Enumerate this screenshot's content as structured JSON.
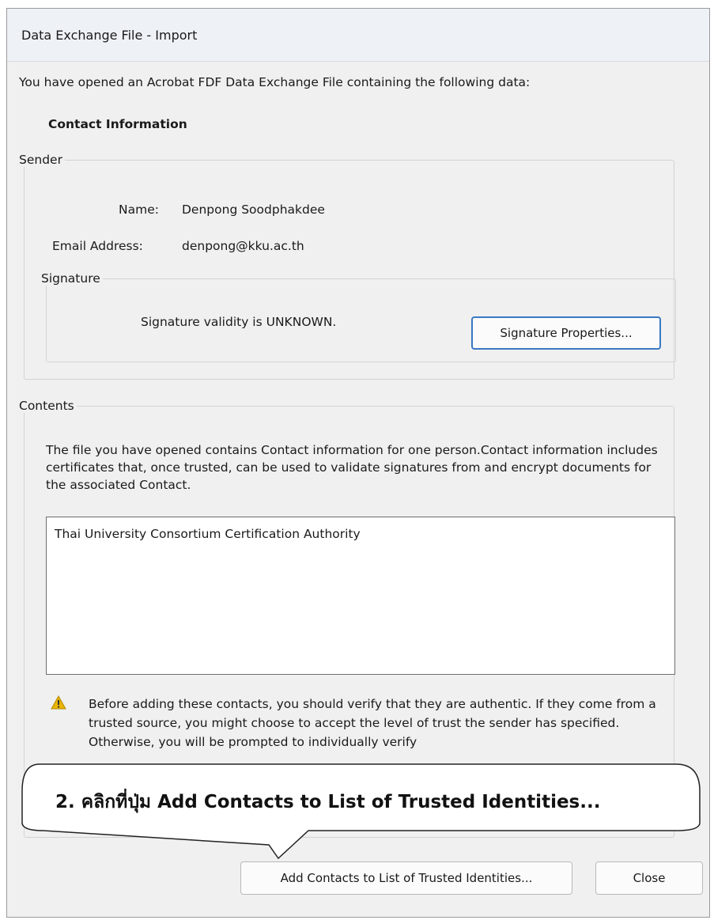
{
  "window": {
    "title": "Data Exchange File - Import"
  },
  "intro_text": "You have opened an Acrobat FDF Data Exchange File containing the following data:",
  "section_heading": "Contact Information",
  "sender": {
    "legend": "Sender",
    "name_label": "Name:",
    "name_value": "Denpong Soodphakdee",
    "email_label": "Email Address:",
    "email_value": "denpong@kku.ac.th"
  },
  "signature": {
    "legend": "Signature",
    "status": "Signature validity is UNKNOWN.",
    "properties_button": "Signature Properties..."
  },
  "contents": {
    "legend": "Contents",
    "description": "The file you have opened contains Contact information for one person.Contact information includes certificates that, once trusted, can be used to validate signatures from and encrypt documents for the associated Contact.",
    "items": [
      "Thai University Consortium Certification Authority"
    ],
    "warning": "Before adding these contacts, you should verify that they are authentic. If they come from a trusted source, you might choose to accept the level of trust the sender has specified. Otherwise, you will be prompted to individually verify"
  },
  "buttons": {
    "add_contacts": "Add Contacts to List of Trusted Identities...",
    "close": "Close"
  },
  "callout": {
    "text": "2. คลิกที่ปุ่ม Add Contacts to List of Trusted Identities..."
  },
  "colors": {
    "focus_border": "#3a78c4",
    "warning_icon": "#e8b400"
  }
}
